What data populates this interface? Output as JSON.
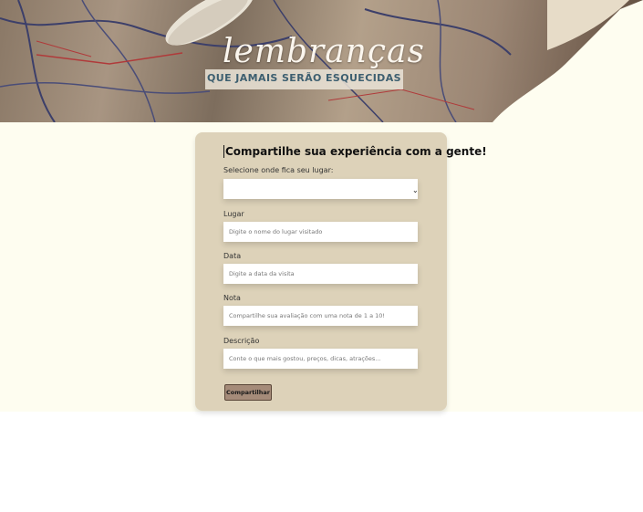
{
  "banner": {
    "title": "lembranças",
    "subtitle": "QUE JAMAIS SERÃO ESQUECIDAS"
  },
  "form": {
    "heading": "Compartilhe sua experiência com a gente!",
    "select_label": "Selecione onde fica seu lugar:",
    "select_value": "",
    "lugar_label": "Lugar",
    "lugar_placeholder": "Digite o nome do lugar visitado",
    "data_label": "Data",
    "data_placeholder": "Digite a data da visita",
    "nota_label": "Nota",
    "nota_placeholder": "Compartilhe sua avaliação com uma nota de 1 a 10!",
    "descricao_label": "Descrição",
    "descricao_placeholder": "Conte o que mais gostou, preços, dicas, atrações...",
    "submit_label": "Compartilhar"
  },
  "colors": {
    "cream_background": "#fefdf0",
    "card_background": "#ddd2b9",
    "button_background": "#a58b79",
    "subtitle_text": "#3d5f70"
  },
  "icons": {
    "select_chevron": "chevron-down-icon"
  }
}
